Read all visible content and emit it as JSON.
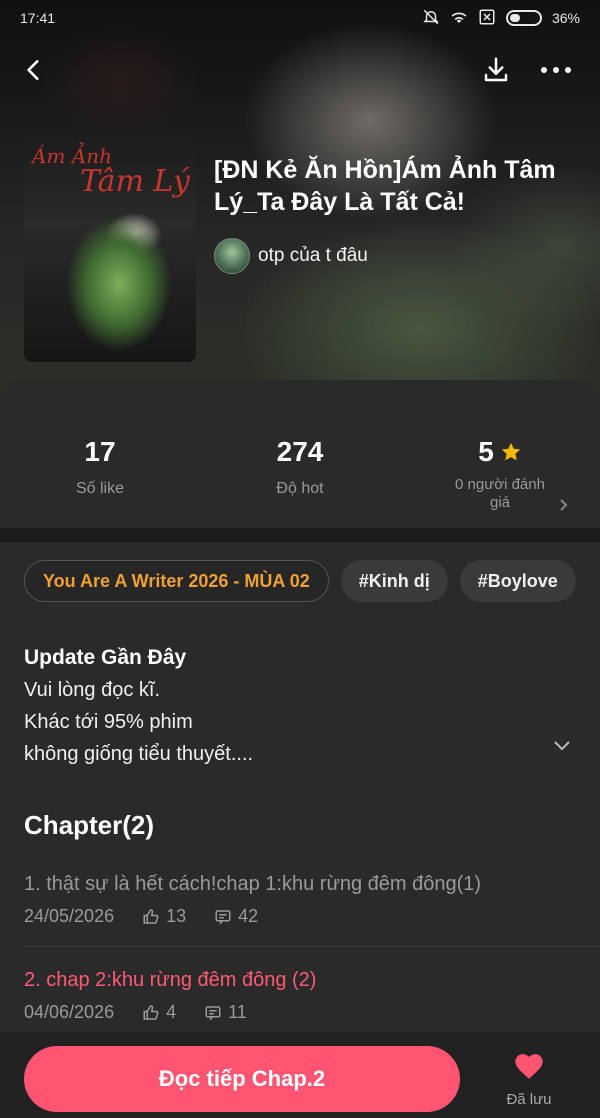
{
  "status": {
    "time": "17:41",
    "battery": "36%",
    "battery_level": 0.36
  },
  "book": {
    "title": "[ĐN Kẻ Ăn Hồn]Ám Ảnh Tâm Lý_Ta Đây Là Tất Cả!",
    "cover_text_line1": "Ám Ảnh",
    "cover_text_line2": "Tâm Lý",
    "author": "otp của t đâu"
  },
  "stats": {
    "likes_value": "17",
    "likes_label": "Số like",
    "hot_value": "274",
    "hot_label": "Độ hot",
    "rating_value": "5",
    "rating_label": "0 người đánh giá"
  },
  "tags": [
    {
      "label": "You Are A Writer 2026 - MÙA 02"
    },
    {
      "label": "#Kinh dị"
    },
    {
      "label": "#Boylove"
    }
  ],
  "update": {
    "title": "Update Gần Đây",
    "lines": [
      "Vui lòng đọc kĩ.",
      "Khác tới 95% phim",
      "không giống tiểu thuyết...."
    ]
  },
  "chapters": {
    "heading": "Chapter(2)",
    "items": [
      {
        "title": "1. thật sự là hết cách!chap 1:khu rừng đêm đông(1)",
        "date": "24/05/2026",
        "likes": "13",
        "comments": "42"
      },
      {
        "title": "2. chap 2:khu rừng đêm đông (2)",
        "date": "04/06/2026",
        "likes": "4",
        "comments": "11"
      }
    ]
  },
  "actions": {
    "read_label": "Đọc tiếp Chap.2",
    "saved_label": "Đã lưu"
  },
  "colors": {
    "accent": "#ff5572",
    "featured_tag": "#f0a030",
    "star": "#f5b800"
  }
}
